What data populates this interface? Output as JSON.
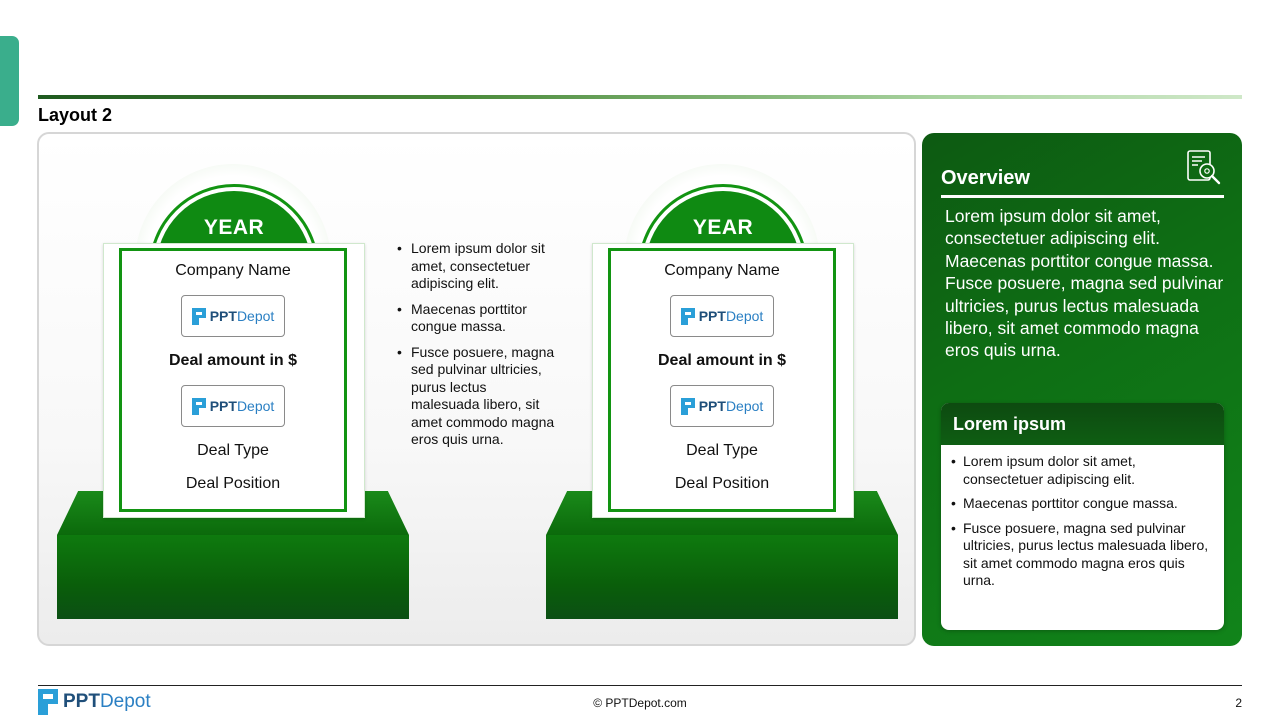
{
  "slide": {
    "title": "Layout 2",
    "page_number": "2",
    "copyright": "© PPTDepot.com"
  },
  "brand": {
    "logo_text_bold": "PPT",
    "logo_text_light": "Depot",
    "logo_icon": "pptdepot-logo-icon"
  },
  "cards": [
    {
      "year": "YEAR",
      "company": "Company Name",
      "deal_amount": "Deal amount in $",
      "deal_type": "Deal Type",
      "deal_position": "Deal Position"
    },
    {
      "year": "YEAR",
      "company": "Company Name",
      "deal_amount": "Deal amount in $",
      "deal_type": "Deal Type",
      "deal_position": "Deal Position"
    }
  ],
  "middle_bullets": [
    "Lorem ipsum dolor sit amet, consectetuer adipiscing elit.",
    "Maecenas porttitor congue massa.",
    "Fusce posuere, magna sed pulvinar ultricies, purus lectus malesuada libero, sit amet commodo magna eros quis urna."
  ],
  "overview": {
    "title": "Overview",
    "icon": "document-search-icon",
    "text": "Lorem ipsum dolor sit amet, consectetuer adipiscing elit. Maecenas porttitor congue massa. Fusce posuere, magna sed pulvinar ultricies, purus lectus malesuada libero, sit amet commodo magna eros quis urna."
  },
  "sub_card": {
    "title": "Lorem ipsum",
    "bullets": [
      "Lorem ipsum dolor sit amet, consectetuer adipiscing elit.",
      "Maecenas porttitor congue massa.",
      "Fusce posuere, magna sed pulvinar ultricies, purus lectus malesuada libero, sit amet commodo magna eros quis urna."
    ]
  },
  "colors": {
    "accent_green": "#129412",
    "dark_green": "#0d5a12",
    "teal_tab": "#3aae8c",
    "brand_blue": "#2a7fc3"
  }
}
